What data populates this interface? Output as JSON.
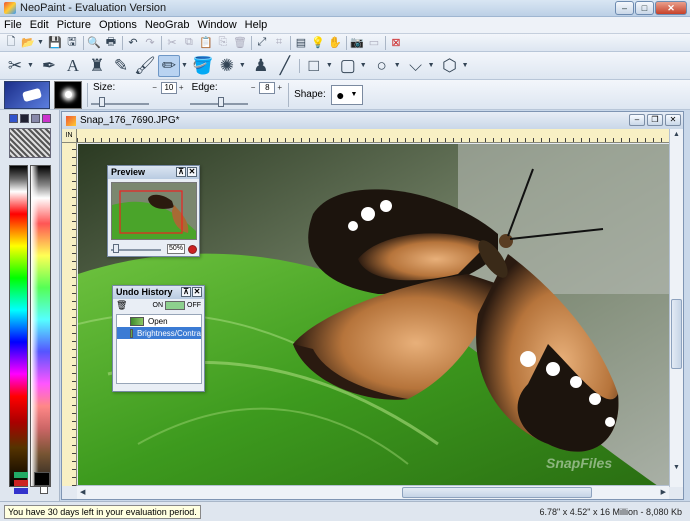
{
  "window": {
    "title": "NeoPaint - Evaluation Version",
    "min": "–",
    "max": "□",
    "close": "✕"
  },
  "menu": [
    "File",
    "Edit",
    "Picture",
    "Options",
    "NeoGrab",
    "Window",
    "Help"
  ],
  "options_bar": {
    "size_label": "Size:",
    "size_value": "10",
    "edge_label": "Edge:",
    "edge_value": "8",
    "shape_label": "Shape:",
    "shape_symbol": "●",
    "size_fraction": 0.15,
    "edge_fraction": 0.55
  },
  "document": {
    "title": "Snap_176_7690.JPG*",
    "ruler_unit": "IN",
    "min": "–",
    "restore": "❐",
    "close": "✕"
  },
  "preview_panel": {
    "title": "Preview",
    "zoom": "50%"
  },
  "undo_panel": {
    "title": "Undo History",
    "on_label": "ON",
    "off_label": "OFF",
    "items": [
      {
        "label": "Open",
        "selected": false
      },
      {
        "label": "Brightness/Contra",
        "selected": true
      }
    ]
  },
  "status": {
    "message": "You have 30 days left in your evaluation period.",
    "info": "6.78\" x 4.52\" x 16 Million - 8,080 Kb"
  },
  "colors": {
    "accent": "#3b7bd4",
    "titlebar": "#c9d7e8",
    "ruler": "#f8f0c4"
  },
  "icons": {
    "toolbar1": [
      "new-icon",
      "open-icon",
      "save-icon",
      "save-as-icon",
      "print-preview-icon",
      "print-icon",
      "cut-icon",
      "copy-icon",
      "paste-icon",
      "paste-new-icon",
      "delete-icon",
      "undo-icon",
      "redo-icon",
      "scanner-icon",
      "camera-icon",
      "grab-icon",
      "bulb-icon",
      "help-icon",
      "close-doc-icon"
    ],
    "toolbar2": [
      "scissors-icon",
      "airbrush-icon",
      "text-icon",
      "stamp-icon",
      "dropper-icon",
      "brush-icon",
      "pen-icon",
      "fill-icon",
      "spray-icon",
      "clone-icon",
      "line-icon",
      "rectangle-icon",
      "rounded-rect-icon",
      "ellipse-icon",
      "polygon-icon",
      "cube-icon"
    ]
  }
}
